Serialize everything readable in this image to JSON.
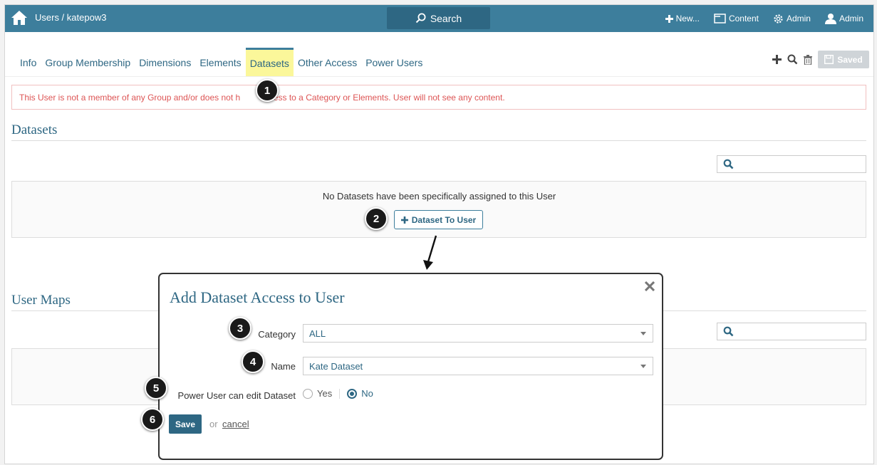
{
  "topbar": {
    "breadcrumb": "Users / katepow3",
    "search_label": "Search",
    "new_label": "New...",
    "content_label": "Content",
    "admin_label": "Admin",
    "user_label": "Admin",
    "color": "#3d7e9c"
  },
  "tabs": [
    {
      "label": "Info",
      "active": false
    },
    {
      "label": "Group Membership",
      "active": false
    },
    {
      "label": "Dimensions",
      "active": false
    },
    {
      "label": "Elements",
      "active": false
    },
    {
      "label": "Datasets",
      "active": true
    },
    {
      "label": "Other Access",
      "active": false
    },
    {
      "label": "Power Users",
      "active": false
    }
  ],
  "toolbar": {
    "saved_label": "Saved"
  },
  "alert": {
    "text_before": "This User is not a member of any Group and/or does not h",
    "text_after": "access to a Category or Elements. User will not see any content."
  },
  "datasets": {
    "title": "Datasets",
    "empty_text": "No Datasets have been specifically assigned to this User",
    "add_button_label": "Dataset To User"
  },
  "user_maps": {
    "title": "User Maps"
  },
  "modal": {
    "title": "Add Dataset Access to User",
    "category_label": "Category",
    "category_value": "ALL",
    "name_label": "Name",
    "name_value": "Kate Dataset",
    "power_user_label": "Power User can edit Dataset",
    "yes_label": "Yes",
    "no_label": "No",
    "selected": "No",
    "save_label": "Save",
    "or_text": "or",
    "cancel_label": "cancel"
  },
  "steps": [
    "1",
    "2",
    "3",
    "4",
    "5",
    "6"
  ],
  "colors": {
    "accent": "#2e6783",
    "alert": "#dd5555",
    "active_tab_highlight": "#fbf79a"
  }
}
